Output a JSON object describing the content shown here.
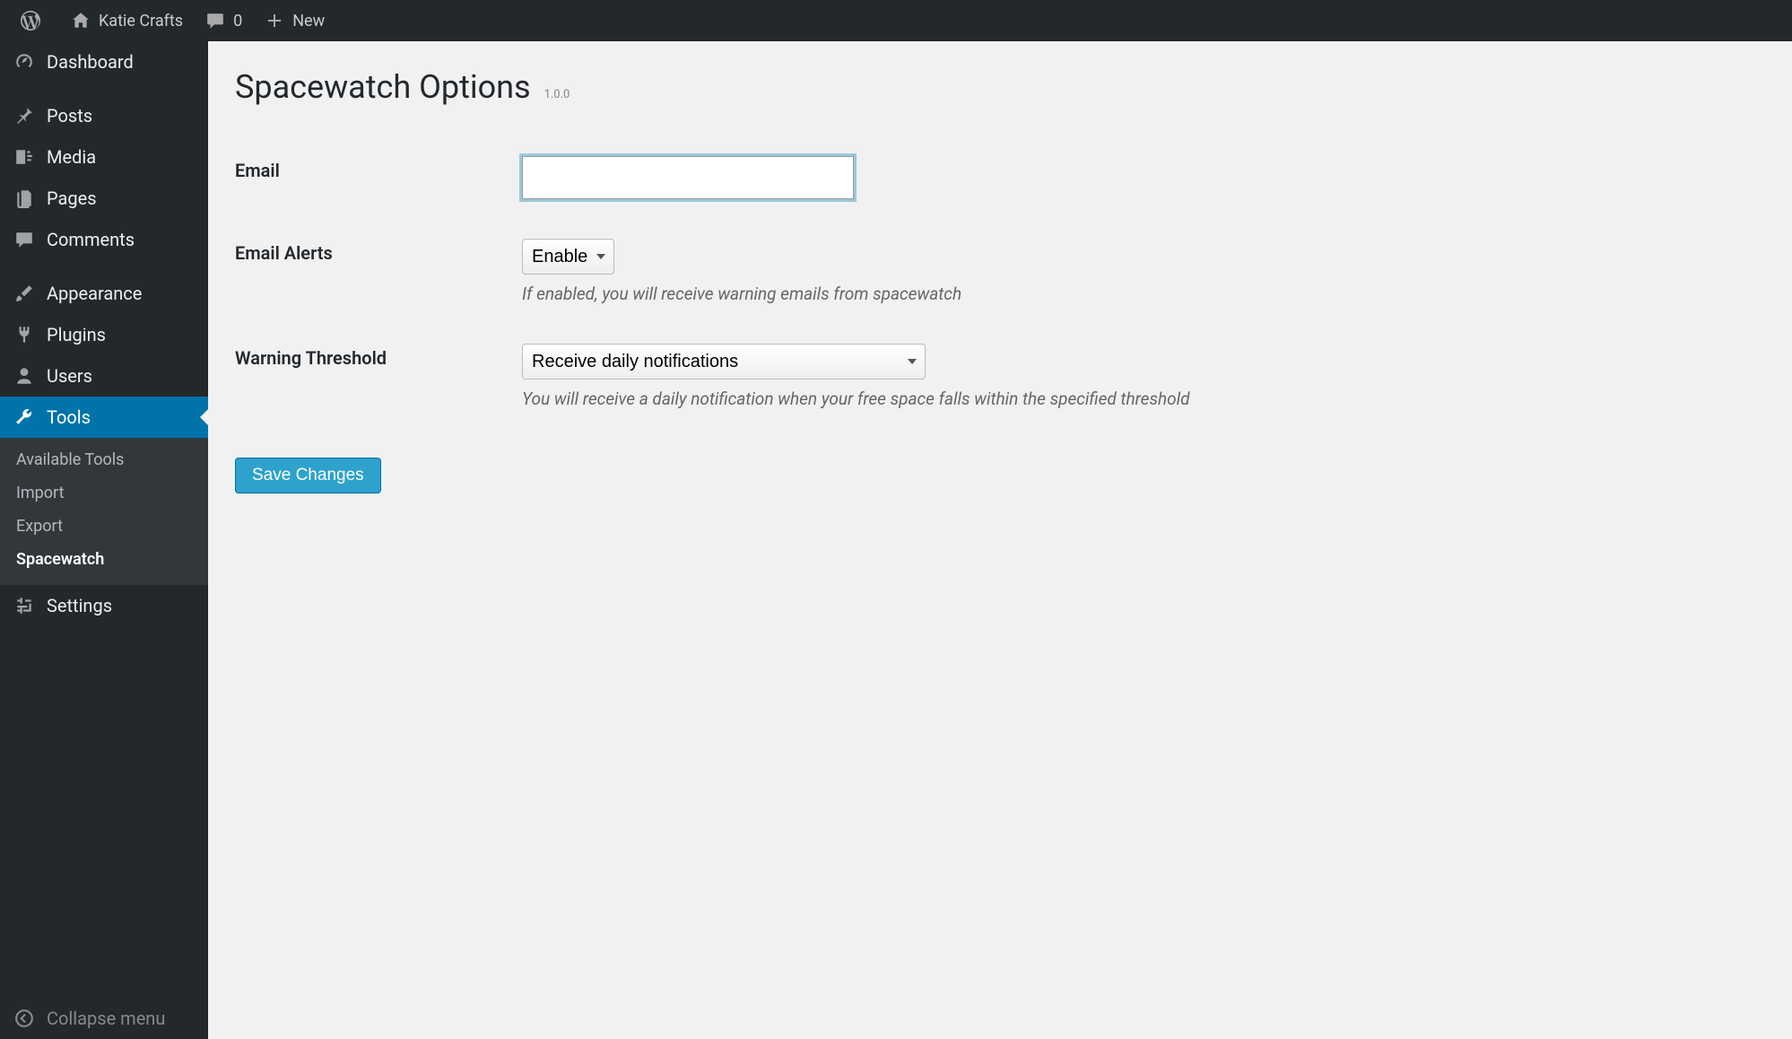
{
  "adminbar": {
    "site_name": "Katie Crafts",
    "comments_count": "0",
    "new_label": "New"
  },
  "sidebar": {
    "items": [
      {
        "label": "Dashboard",
        "icon": "dashboard-icon"
      },
      {
        "label": "Posts",
        "icon": "pin-icon"
      },
      {
        "label": "Media",
        "icon": "media-icon"
      },
      {
        "label": "Pages",
        "icon": "pages-icon"
      },
      {
        "label": "Comments",
        "icon": "comments-icon"
      },
      {
        "label": "Appearance",
        "icon": "brush-icon"
      },
      {
        "label": "Plugins",
        "icon": "plug-icon"
      },
      {
        "label": "Users",
        "icon": "user-icon"
      },
      {
        "label": "Tools",
        "icon": "wrench-icon"
      },
      {
        "label": "Settings",
        "icon": "sliders-icon"
      }
    ],
    "tools_submenu": [
      {
        "label": "Available Tools"
      },
      {
        "label": "Import"
      },
      {
        "label": "Export"
      },
      {
        "label": "Spacewatch"
      }
    ],
    "collapse_label": "Collapse menu"
  },
  "page": {
    "title": "Spacewatch Options",
    "version": "1.0.0",
    "fields": {
      "email": {
        "label": "Email",
        "value": ""
      },
      "email_alerts": {
        "label": "Email Alerts",
        "value": "Enable",
        "description": "If enabled, you will receive warning emails from spacewatch"
      },
      "warning_threshold": {
        "label": "Warning Threshold",
        "value": "Receive daily notifications",
        "description": "You will receive a daily notification when your free space falls within the specified threshold"
      }
    },
    "save_label": "Save Changes"
  }
}
